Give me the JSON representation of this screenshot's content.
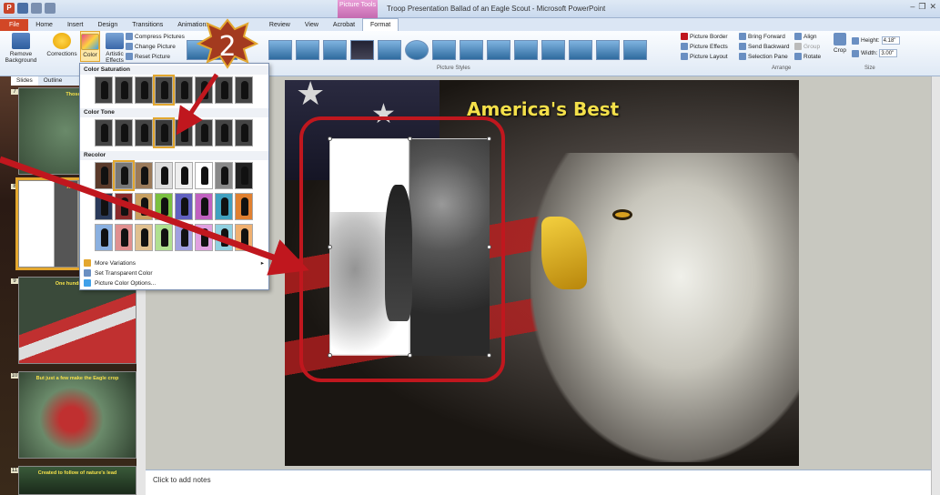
{
  "window": {
    "title": "Troop Presentation Ballad of an Eagle Scout - Microsoft PowerPoint",
    "context_tab_title": "Picture Tools"
  },
  "ribbon_tabs": [
    "File",
    "Home",
    "Insert",
    "Design",
    "Transitions",
    "Animations",
    "Review",
    "View",
    "Acrobat",
    "Format"
  ],
  "ribbon": {
    "remove_background": "Remove Background",
    "corrections": "Corrections",
    "color": "Color",
    "artistic_effects": "Artistic Effects",
    "compress_pictures": "Compress Pictures",
    "change_picture": "Change Picture",
    "reset_picture": "Reset Picture",
    "picture_styles_label": "Picture Styles",
    "picture_border": "Picture Border",
    "picture_effects": "Picture Effects",
    "picture_layout": "Picture Layout",
    "bring_forward": "Bring Forward",
    "send_backward": "Send Backward",
    "selection_pane": "Selection Pane",
    "align": "Align",
    "group": "Group",
    "rotate": "Rotate",
    "arrange_label": "Arrange",
    "crop": "Crop",
    "height_label": "Height:",
    "height_value": "4.18\"",
    "width_label": "Width:",
    "width_value": "3.00\"",
    "size_label": "Size"
  },
  "left_pane": {
    "tabs": [
      "Slides",
      "Outline"
    ],
    "slides": [
      {
        "num": "7",
        "title": "Those c..."
      },
      {
        "num": "8",
        "title": "Americ..."
      },
      {
        "num": "9",
        "title": "One hundred boys"
      },
      {
        "num": "10",
        "title": "But just a few make the Eagle crop"
      },
      {
        "num": "11",
        "title": "Created to follow of nature's lead"
      }
    ]
  },
  "slide": {
    "title": "America's Best"
  },
  "notes_placeholder": "Click to add notes",
  "dropdown": {
    "color_saturation": "Color Saturation",
    "color_tone": "Color Tone",
    "recolor": "Recolor",
    "more_variations": "More Variations",
    "set_transparent_color": "Set Transparent Color",
    "picture_color_options": "Picture Color Options..."
  },
  "callout": {
    "number": "2"
  },
  "colors": {
    "annotation_red": "#c0171e",
    "callout_fill": "#a33a1f",
    "slide_title": "#f4e04a",
    "selection_outline": "#e3a72f"
  }
}
